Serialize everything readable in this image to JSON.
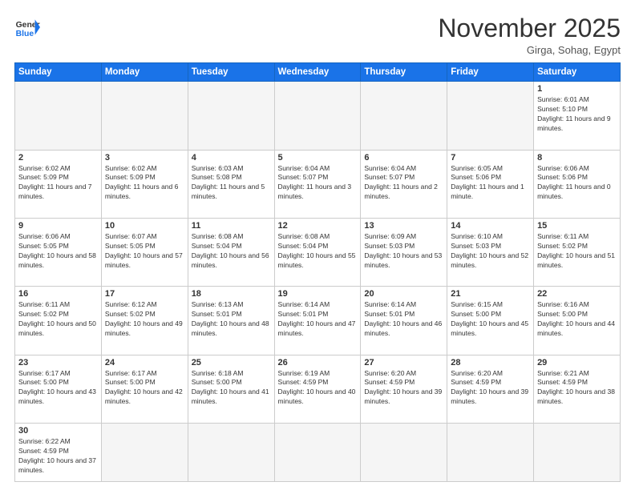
{
  "header": {
    "logo_general": "General",
    "logo_blue": "Blue",
    "month_title": "November 2025",
    "subtitle": "Girga, Sohag, Egypt"
  },
  "weekdays": [
    "Sunday",
    "Monday",
    "Tuesday",
    "Wednesday",
    "Thursday",
    "Friday",
    "Saturday"
  ],
  "weeks": [
    [
      {
        "day": "",
        "info": "",
        "empty": true
      },
      {
        "day": "",
        "info": "",
        "empty": true
      },
      {
        "day": "",
        "info": "",
        "empty": true
      },
      {
        "day": "",
        "info": "",
        "empty": true
      },
      {
        "day": "",
        "info": "",
        "empty": true
      },
      {
        "day": "",
        "info": "",
        "empty": true
      },
      {
        "day": "1",
        "info": "Sunrise: 6:01 AM\nSunset: 5:10 PM\nDaylight: 11 hours and 9 minutes."
      }
    ],
    [
      {
        "day": "2",
        "info": "Sunrise: 6:02 AM\nSunset: 5:09 PM\nDaylight: 11 hours and 7 minutes."
      },
      {
        "day": "3",
        "info": "Sunrise: 6:02 AM\nSunset: 5:09 PM\nDaylight: 11 hours and 6 minutes."
      },
      {
        "day": "4",
        "info": "Sunrise: 6:03 AM\nSunset: 5:08 PM\nDaylight: 11 hours and 5 minutes."
      },
      {
        "day": "5",
        "info": "Sunrise: 6:04 AM\nSunset: 5:07 PM\nDaylight: 11 hours and 3 minutes."
      },
      {
        "day": "6",
        "info": "Sunrise: 6:04 AM\nSunset: 5:07 PM\nDaylight: 11 hours and 2 minutes."
      },
      {
        "day": "7",
        "info": "Sunrise: 6:05 AM\nSunset: 5:06 PM\nDaylight: 11 hours and 1 minute."
      },
      {
        "day": "8",
        "info": "Sunrise: 6:06 AM\nSunset: 5:06 PM\nDaylight: 11 hours and 0 minutes."
      }
    ],
    [
      {
        "day": "9",
        "info": "Sunrise: 6:06 AM\nSunset: 5:05 PM\nDaylight: 10 hours and 58 minutes."
      },
      {
        "day": "10",
        "info": "Sunrise: 6:07 AM\nSunset: 5:05 PM\nDaylight: 10 hours and 57 minutes."
      },
      {
        "day": "11",
        "info": "Sunrise: 6:08 AM\nSunset: 5:04 PM\nDaylight: 10 hours and 56 minutes."
      },
      {
        "day": "12",
        "info": "Sunrise: 6:08 AM\nSunset: 5:04 PM\nDaylight: 10 hours and 55 minutes."
      },
      {
        "day": "13",
        "info": "Sunrise: 6:09 AM\nSunset: 5:03 PM\nDaylight: 10 hours and 53 minutes."
      },
      {
        "day": "14",
        "info": "Sunrise: 6:10 AM\nSunset: 5:03 PM\nDaylight: 10 hours and 52 minutes."
      },
      {
        "day": "15",
        "info": "Sunrise: 6:11 AM\nSunset: 5:02 PM\nDaylight: 10 hours and 51 minutes."
      }
    ],
    [
      {
        "day": "16",
        "info": "Sunrise: 6:11 AM\nSunset: 5:02 PM\nDaylight: 10 hours and 50 minutes."
      },
      {
        "day": "17",
        "info": "Sunrise: 6:12 AM\nSunset: 5:02 PM\nDaylight: 10 hours and 49 minutes."
      },
      {
        "day": "18",
        "info": "Sunrise: 6:13 AM\nSunset: 5:01 PM\nDaylight: 10 hours and 48 minutes."
      },
      {
        "day": "19",
        "info": "Sunrise: 6:14 AM\nSunset: 5:01 PM\nDaylight: 10 hours and 47 minutes."
      },
      {
        "day": "20",
        "info": "Sunrise: 6:14 AM\nSunset: 5:01 PM\nDaylight: 10 hours and 46 minutes."
      },
      {
        "day": "21",
        "info": "Sunrise: 6:15 AM\nSunset: 5:00 PM\nDaylight: 10 hours and 45 minutes."
      },
      {
        "day": "22",
        "info": "Sunrise: 6:16 AM\nSunset: 5:00 PM\nDaylight: 10 hours and 44 minutes."
      }
    ],
    [
      {
        "day": "23",
        "info": "Sunrise: 6:17 AM\nSunset: 5:00 PM\nDaylight: 10 hours and 43 minutes."
      },
      {
        "day": "24",
        "info": "Sunrise: 6:17 AM\nSunset: 5:00 PM\nDaylight: 10 hours and 42 minutes."
      },
      {
        "day": "25",
        "info": "Sunrise: 6:18 AM\nSunset: 5:00 PM\nDaylight: 10 hours and 41 minutes."
      },
      {
        "day": "26",
        "info": "Sunrise: 6:19 AM\nSunset: 4:59 PM\nDaylight: 10 hours and 40 minutes."
      },
      {
        "day": "27",
        "info": "Sunrise: 6:20 AM\nSunset: 4:59 PM\nDaylight: 10 hours and 39 minutes."
      },
      {
        "day": "28",
        "info": "Sunrise: 6:20 AM\nSunset: 4:59 PM\nDaylight: 10 hours and 39 minutes."
      },
      {
        "day": "29",
        "info": "Sunrise: 6:21 AM\nSunset: 4:59 PM\nDaylight: 10 hours and 38 minutes."
      }
    ],
    [
      {
        "day": "30",
        "info": "Sunrise: 6:22 AM\nSunset: 4:59 PM\nDaylight: 10 hours and 37 minutes."
      },
      {
        "day": "",
        "info": "",
        "empty": true
      },
      {
        "day": "",
        "info": "",
        "empty": true
      },
      {
        "day": "",
        "info": "",
        "empty": true
      },
      {
        "day": "",
        "info": "",
        "empty": true
      },
      {
        "day": "",
        "info": "",
        "empty": true
      },
      {
        "day": "",
        "info": "",
        "empty": true
      }
    ]
  ]
}
